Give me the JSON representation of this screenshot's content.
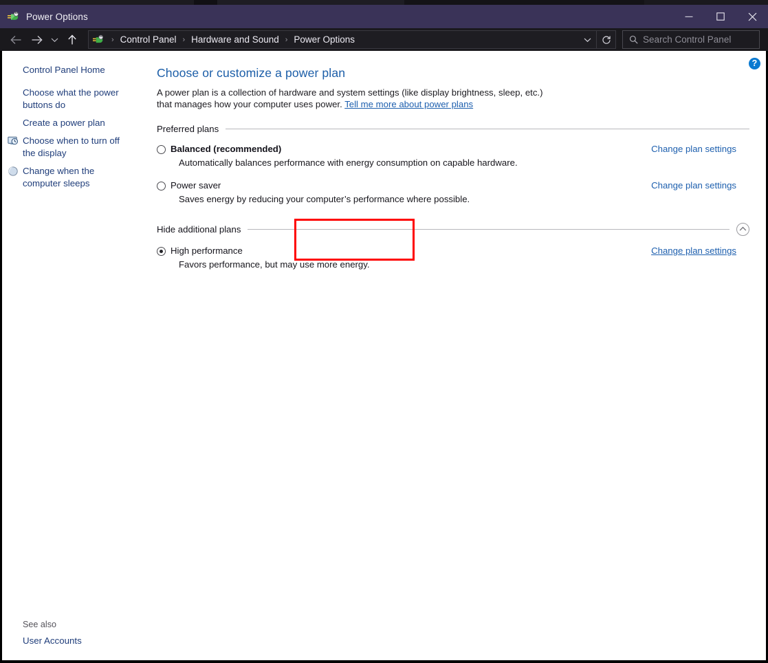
{
  "window": {
    "title": "Power Options",
    "icon": "power-plug-icon",
    "minimize_label": "Minimize",
    "maximize_label": "Maximize",
    "close_label": "Close"
  },
  "addressbar": {
    "back_label": "Back",
    "forward_label": "Forward",
    "recent_label": "Recent locations",
    "up_label": "Up one level",
    "breadcrumbs": [
      "Control Panel",
      "Hardware and Sound",
      "Power Options"
    ],
    "separator": "›",
    "dropdown_label": "Previous locations",
    "refresh_label": "Refresh",
    "search": {
      "placeholder": "Search Control Panel",
      "value": "",
      "icon": "search-icon"
    }
  },
  "sidebar": {
    "home": "Control Panel Home",
    "items": [
      {
        "label": "Choose what the power buttons do",
        "icon": null
      },
      {
        "label": "Create a power plan",
        "icon": null
      },
      {
        "label": "Choose when to turn off the display",
        "icon": "display-clock-icon"
      },
      {
        "label": "Change when the computer sleeps",
        "icon": "sleep-moon-icon"
      }
    ],
    "see_also_label": "See also",
    "see_also_link": "User Accounts"
  },
  "content": {
    "title": "Choose or customize a power plan",
    "intro_text": "A power plan is a collection of hardware and system settings (like display brightness, sleep, etc.) that manages how your computer uses power.",
    "intro_link": "Tell me more about power plans",
    "help_icon": "help-icon",
    "help_glyph": "?",
    "groups": [
      {
        "heading": "Preferred plans",
        "collapse_button": null,
        "plans": [
          {
            "name": "Balanced (recommended)",
            "bold": true,
            "selected": false,
            "description": "Automatically balances performance with energy consumption on capable hardware.",
            "link": "Change plan settings",
            "link_hovered": false,
            "highlighted": false
          },
          {
            "name": "Power saver",
            "bold": false,
            "selected": false,
            "description": "Saves energy by reducing your computer’s performance where possible.",
            "link": "Change plan settings",
            "link_hovered": false,
            "highlighted": false
          }
        ]
      },
      {
        "heading": "Hide additional plans",
        "collapse_button": "chevron-up-icon",
        "plans": [
          {
            "name": "High performance",
            "bold": false,
            "selected": true,
            "description": "Favors performance, but may use more energy.",
            "link": "Change plan settings",
            "link_hovered": true,
            "highlighted": true
          }
        ]
      }
    ]
  },
  "annotation": {
    "color": "#fe0000",
    "target": "Change plan settings (High performance)"
  },
  "colors": {
    "titlebar": "#3a3358",
    "addressbar": "#1a191d",
    "accent_link": "#1d5fae",
    "heading": "#1c5ea8",
    "highlight": "#fe0000",
    "help": "#0a7ad1"
  }
}
